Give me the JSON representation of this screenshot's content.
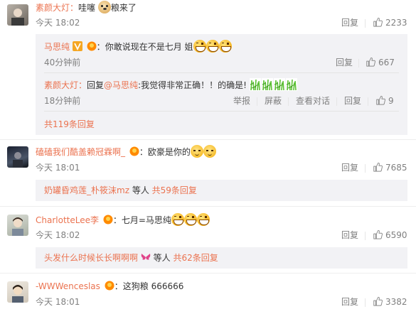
{
  "ui": {
    "like_label": "like",
    "reply_label": "回复"
  },
  "c1": {
    "user": "素颜大灯：",
    "text_a": "哇噻",
    "text_b": "粮来了",
    "time": "今天 18:02",
    "reply": "回复",
    "likes": "2233",
    "replies": [
      {
        "user": "马思纯",
        "colon": "：",
        "text": "你敢说现在不是七月 姐",
        "time": "40分钟前",
        "reply": "回复",
        "likes": "667"
      },
      {
        "user": "素颜大灯：",
        "pre": "回复",
        "mention": "@马思纯",
        "text": ":我觉得非常正确！！的确是!",
        "time": "18分钟前",
        "report": "举报",
        "block": "屏蔽",
        "view_conv": "查看对话",
        "reply": "回复",
        "likes": "9"
      }
    ],
    "more": "共119条回复"
  },
  "c2": {
    "user": "磕磕我们酷盖赖冠霖啊_",
    "colon": "：",
    "text": "欧豪是你的",
    "time": "今天 18:01",
    "reply": "回复",
    "likes": "7685",
    "sub_users": "奶罐昏鸡莲_朴筱沫mz",
    "sub_mid": " 等人 ",
    "more": "共59条回复"
  },
  "c3": {
    "user": "CharlotteLee李",
    "colon": "：",
    "text": "七月=马思纯",
    "time": "今天 18:02",
    "reply": "回复",
    "likes": "6590",
    "sub_users": "头发什么时候长长啊啊啊",
    "sub_mid": " 等人 ",
    "more": "共62条回复"
  },
  "c4": {
    "user": "-WWWenceslas",
    "colon": "：",
    "text": "这狗粮 666666",
    "time": "今天 18:01",
    "reply": "回复",
    "likes": "3382"
  },
  "colors": {
    "accent": "#eb7350",
    "muted": "#808080",
    "reply_bg": "#f2f2f5"
  }
}
